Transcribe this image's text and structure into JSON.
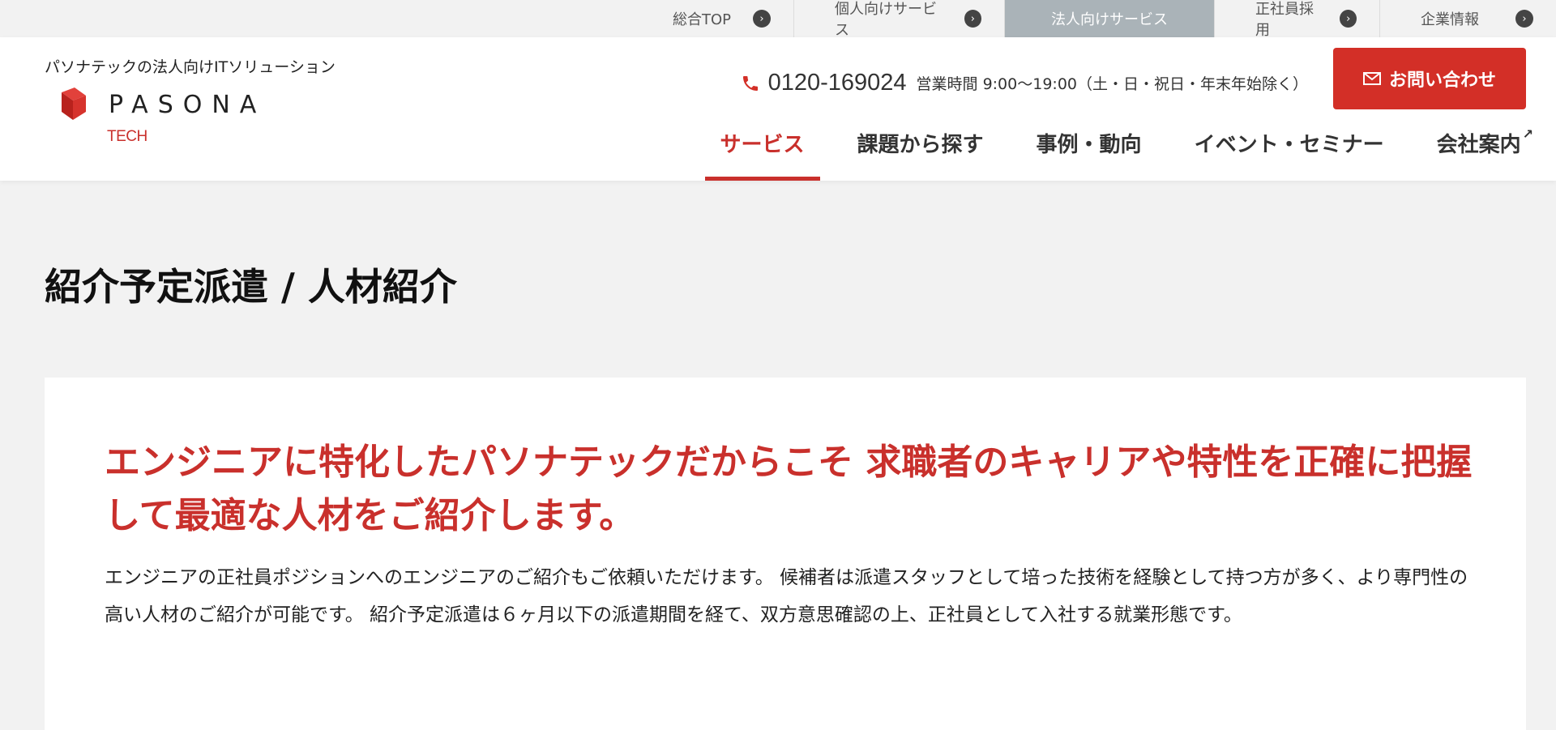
{
  "topbar": {
    "items": [
      {
        "label": "総合TOP",
        "active": false
      },
      {
        "label": "個人向けサービス",
        "active": false
      },
      {
        "label": "法人向けサービス",
        "active": true
      },
      {
        "label": "正社員採用",
        "active": false
      },
      {
        "label": "企業情報",
        "active": false
      }
    ]
  },
  "header": {
    "tagline": "パソナテックの法人向けITソリューション",
    "logo": {
      "word": "PASONA",
      "sub": "TECH",
      "icon": "pasona-logo-mark"
    },
    "phone": {
      "number": "0120-169024",
      "hours": "営業時間 9:00〜19:00（土・日・祝日・年末年始除く）",
      "icon": "phone-icon"
    },
    "inquiry_label": "お問い合わせ",
    "nav": [
      {
        "label": "サービス",
        "active": true
      },
      {
        "label": "課題から探す",
        "active": false
      },
      {
        "label": "事例・動向",
        "active": false
      },
      {
        "label": "イベント・セミナー",
        "active": false
      },
      {
        "label": "会社案内",
        "active": false,
        "external": true
      }
    ]
  },
  "page": {
    "title": "紹介予定派遣 / 人材紹介"
  },
  "content": {
    "headline": "エンジニアに特化したパソナテックだからこそ 求職者のキャリアや特性を正確に把握して最適な人材をご紹介します。",
    "body": "エンジニアの正社員ポジションへのエンジニアのご紹介もご依頼いただけます。 候補者は派遣スタッフとして培った技術を経験として持つ方が多く、より専門性の高い人材のご紹介が可能です。 紹介予定派遣は６ヶ月以下の派遣期間を経て、双方意思確認の上、正社員として入社する就業形態です。"
  },
  "colors": {
    "accent": "#c9302c",
    "button": "#d32f27",
    "topbar_active": "#aab3b8",
    "background": "#f2f2f2"
  }
}
